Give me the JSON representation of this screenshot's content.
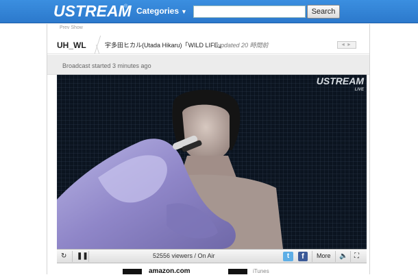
{
  "header": {
    "logo_text": "USTREAM",
    "logo_mark": "®",
    "categories_label": "Categories",
    "search_placeholder": "",
    "search_button": "Search"
  },
  "page": {
    "prev_show": "Prev Show",
    "channel_name": "UH_WL",
    "channel_title": "宇多田ヒカル(Utada Hikaru)「WILD LIFE」",
    "updated_text": "updated 20 時間前",
    "broadcast_status": "Broadcast started 3 minutes ago"
  },
  "video": {
    "watermark": "USTREAM",
    "watermark_sub": "LIVE"
  },
  "controls": {
    "viewers_text": "52556 viewers / On Air",
    "more_label": "More"
  },
  "footer": {
    "amazon_text": "amazon.com",
    "itunes_text": "iTunes"
  },
  "colors": {
    "header_blue": "#2c79cc",
    "twitter": "#5eaee6",
    "facebook": "#3b5a98"
  }
}
